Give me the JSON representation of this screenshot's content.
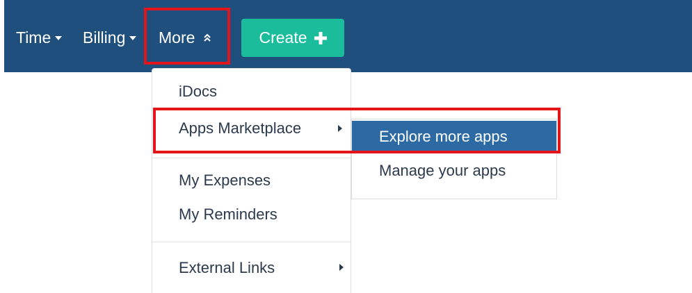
{
  "navbar": {
    "time_label": "Time",
    "billing_label": "Billing",
    "more_label": "More",
    "create_label": "Create"
  },
  "more_menu": {
    "items": [
      {
        "label": "iDocs"
      },
      {
        "label": "Apps Marketplace"
      },
      {
        "label": "My Expenses"
      },
      {
        "label": "My Reminders"
      },
      {
        "label": "External Links"
      }
    ]
  },
  "apps_submenu": {
    "items": [
      {
        "label": "Explore more apps",
        "highlighted": true
      },
      {
        "label": "Manage your apps"
      }
    ]
  },
  "colors": {
    "navbar_bg": "#1f4f7d",
    "create_button": "#1bbc9b",
    "highlight_item": "#2d6aa3",
    "annotation_box": "#e3141c"
  },
  "icons": [
    "caret-down-icon",
    "double-chevron-up-icon",
    "plus-icon",
    "caret-right-icon"
  ]
}
